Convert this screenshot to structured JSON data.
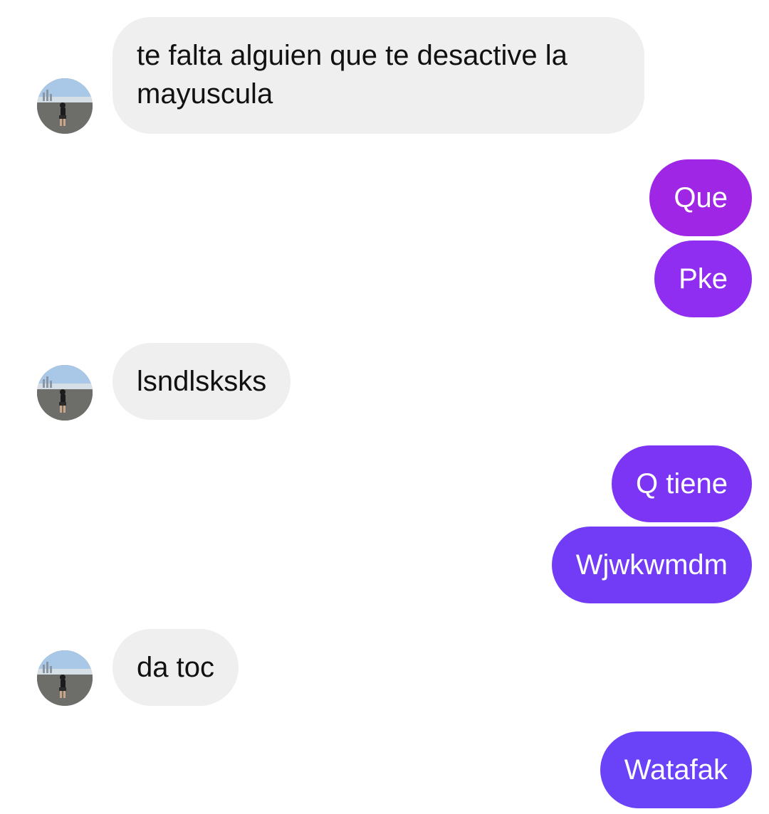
{
  "conversation": {
    "messages": [
      {
        "sender": "them",
        "text": "te falta alguien que te desactive la mayuscula"
      },
      {
        "sender": "me",
        "text": "Que"
      },
      {
        "sender": "me",
        "text": "Pke"
      },
      {
        "sender": "them",
        "text": "lsndlsksks"
      },
      {
        "sender": "me",
        "text": "Q tiene"
      },
      {
        "sender": "me",
        "text": "Wjwkwmdm"
      },
      {
        "sender": "them",
        "text": "da toc"
      },
      {
        "sender": "me",
        "text": "Watafak"
      }
    ]
  },
  "colors": {
    "incoming_bubble": "#efefef",
    "outgoing_gradient_top": "#a026e6",
    "outgoing_gradient_bottom": "#6a42f8"
  },
  "icons": {
    "avatar": "contact-avatar-photo-beach"
  }
}
